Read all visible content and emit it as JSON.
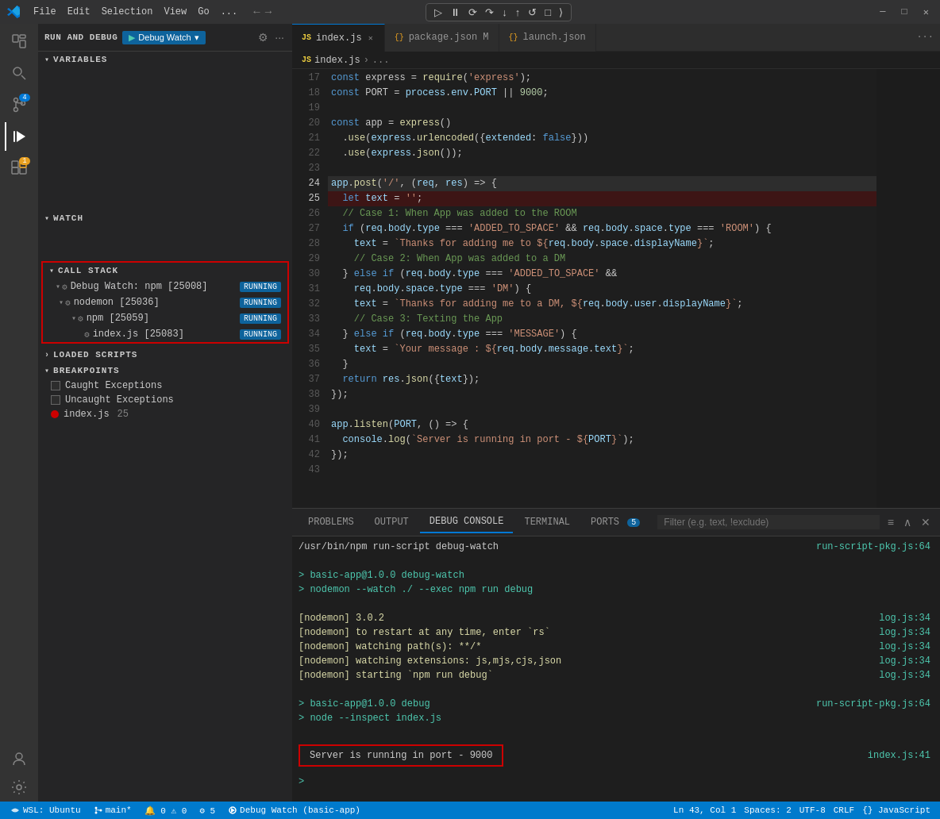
{
  "titlebar": {
    "menus": [
      "File",
      "Edit",
      "Selection",
      "View",
      "Go",
      "..."
    ],
    "debug_toolbar": {
      "buttons": [
        "⏸",
        "▶",
        "⟳",
        "↓",
        "↑",
        "↺",
        "□",
        "⟩",
        "≡"
      ]
    },
    "window_controls": [
      "─",
      "□",
      "✕"
    ]
  },
  "activity_bar": {
    "icons": [
      {
        "name": "explorer-icon",
        "symbol": "⬡",
        "active": false
      },
      {
        "name": "search-icon",
        "symbol": "🔍",
        "active": false
      },
      {
        "name": "source-control-icon",
        "symbol": "⎇",
        "active": false,
        "badge": "4"
      },
      {
        "name": "run-debug-icon",
        "symbol": "▷",
        "active": true
      },
      {
        "name": "extensions-icon",
        "symbol": "⊞",
        "active": false,
        "badge": "1",
        "badge_color": "orange"
      },
      {
        "name": "accounts-icon",
        "symbol": "👤",
        "active": false,
        "bottom": true
      },
      {
        "name": "settings-icon",
        "symbol": "⚙",
        "active": false,
        "bottom": true
      }
    ]
  },
  "sidebar": {
    "run_debug_label": "RUN AND DEBUG",
    "debug_config": "Debug Watch",
    "sections": {
      "variables": {
        "label": "VARIABLES",
        "expanded": true
      },
      "watch": {
        "label": "WATCH",
        "expanded": true
      },
      "call_stack": {
        "label": "CALL STACK",
        "expanded": true,
        "items": [
          {
            "label": "Debug Watch: npm [25008]",
            "status": "RUNNING",
            "indent": 0
          },
          {
            "label": "nodemon [25036]",
            "status": "RUNNING",
            "indent": 1
          },
          {
            "label": "npm [25059]",
            "status": "RUNNING",
            "indent": 2
          },
          {
            "label": "index.js [25083]",
            "status": "RUNNING",
            "indent": 3
          }
        ]
      },
      "loaded_scripts": {
        "label": "LOADED SCRIPTS",
        "expanded": false
      },
      "breakpoints": {
        "label": "BREAKPOINTS",
        "expanded": true,
        "items": [
          {
            "label": "Caught Exceptions",
            "checked": false
          },
          {
            "label": "Uncaught Exceptions",
            "checked": false
          },
          {
            "label": "index.js",
            "is_file": true,
            "line": 25
          }
        ]
      }
    }
  },
  "editor": {
    "tabs": [
      {
        "label": "index.js",
        "icon": "JS",
        "active": true,
        "closeable": true
      },
      {
        "label": "package.json M",
        "icon": "{}",
        "active": false
      },
      {
        "label": "launch.json",
        "icon": "{}",
        "active": false
      }
    ],
    "breadcrumb": [
      "JS index.js",
      ">",
      "..."
    ],
    "lines": [
      {
        "num": 17,
        "content": "const express = require('express');",
        "tokens": [
          {
            "t": "keyword",
            "v": "const"
          },
          {
            "t": "op",
            "v": " express "
          },
          {
            "t": "op",
            "v": "= "
          },
          {
            "t": "func",
            "v": "require"
          },
          {
            "t": "op",
            "v": "("
          },
          {
            "t": "string",
            "v": "'express'"
          },
          {
            "t": "op",
            "v": ");"
          }
        ]
      },
      {
        "num": 18,
        "content": "const PORT = process.env.PORT || 9000;",
        "tokens": [
          {
            "t": "keyword",
            "v": "const"
          },
          {
            "t": "op",
            "v": " PORT "
          },
          {
            "t": "op",
            "v": "= "
          },
          {
            "t": "var",
            "v": "process"
          },
          {
            "t": "op",
            "v": "."
          },
          {
            "t": "prop",
            "v": "env"
          },
          {
            "t": "op",
            "v": "."
          },
          {
            "t": "prop",
            "v": "PORT"
          },
          {
            "t": "op",
            "v": " || "
          },
          {
            "t": "number",
            "v": "9000"
          },
          {
            "t": "op",
            "v": ";"
          }
        ]
      },
      {
        "num": 19,
        "content": ""
      },
      {
        "num": 20,
        "content": "const app = express()"
      },
      {
        "num": 21,
        "content": "  .use(express.urlencoded({extended: false}))"
      },
      {
        "num": 22,
        "content": "  .use(express.json());"
      },
      {
        "num": 23,
        "content": ""
      },
      {
        "num": 24,
        "content": "app.post('/', (req, res) => {",
        "highlighted": true
      },
      {
        "num": 25,
        "content": "  let text = '';",
        "breakpoint": true
      },
      {
        "num": 26,
        "content": "  // Case 1: When App was added to the ROOM"
      },
      {
        "num": 27,
        "content": "  if (req.body.type === 'ADDED_TO_SPACE' && req.body.space.type === 'ROOM') {"
      },
      {
        "num": 28,
        "content": "    text = `Thanks for adding me to ${req.body.space.displayName}`;"
      },
      {
        "num": 29,
        "content": "    // Case 2: When App was added to a DM"
      },
      {
        "num": 30,
        "content": "  } else if (req.body.type === 'ADDED_TO_SPACE' &&"
      },
      {
        "num": 31,
        "content": "    req.body.space.type === 'DM') {"
      },
      {
        "num": 32,
        "content": "    text = `Thanks for adding me to a DM, ${req.body.user.displayName}`;"
      },
      {
        "num": 33,
        "content": "    // Case 3: Texting the App"
      },
      {
        "num": 34,
        "content": "  } else if (req.body.type === 'MESSAGE') {"
      },
      {
        "num": 35,
        "content": "    text = `Your message : ${req.body.message.text}`;"
      },
      {
        "num": 36,
        "content": "  }"
      },
      {
        "num": 37,
        "content": "  return res.json({text});"
      },
      {
        "num": 38,
        "content": "});"
      },
      {
        "num": 39,
        "content": ""
      },
      {
        "num": 40,
        "content": "app.listen(PORT, () => {"
      },
      {
        "num": 41,
        "content": "  console.log(`Server is running in port - ${PORT}`);"
      },
      {
        "num": 42,
        "content": "});"
      },
      {
        "num": 43,
        "content": ""
      }
    ]
  },
  "panel": {
    "tabs": [
      {
        "label": "PROBLEMS",
        "active": false
      },
      {
        "label": "OUTPUT",
        "active": false
      },
      {
        "label": "DEBUG CONSOLE",
        "active": true
      },
      {
        "label": "TERMINAL",
        "active": false
      },
      {
        "label": "PORTS",
        "active": false,
        "badge": "5"
      }
    ],
    "filter_placeholder": "Filter (e.g. text, !exclude)",
    "console_lines": [
      {
        "text": "/usr/bin/npm run-script debug-watch",
        "link": "run-script-pkg.js:64",
        "color": ""
      },
      {
        "text": "",
        "link": "",
        "color": ""
      },
      {
        "text": "> basic-app@1.0.0 debug-watch",
        "link": "",
        "color": "green"
      },
      {
        "text": "> nodemon --watch ./ --exec npm run debug",
        "link": "",
        "color": "green"
      },
      {
        "text": "",
        "link": "",
        "color": ""
      },
      {
        "text": "[nodemon] 3.0.2",
        "link": "log.js:34",
        "color": "yellow"
      },
      {
        "text": "[nodemon] to restart at any time, enter `rs`",
        "link": "log.js:34",
        "color": "yellow"
      },
      {
        "text": "[nodemon] watching path(s): **/*",
        "link": "log.js:34",
        "color": "yellow"
      },
      {
        "text": "[nodemon] watching extensions: js,mjs,cjs,json",
        "link": "log.js:34",
        "color": "yellow"
      },
      {
        "text": "[nodemon] starting `npm run debug`",
        "link": "log.js:34",
        "color": "yellow"
      },
      {
        "text": "",
        "link": "",
        "color": ""
      },
      {
        "text": "> basic-app@1.0.0 debug",
        "link": "run-script-pkg.js:64",
        "color": "green"
      },
      {
        "text": "> node --inspect index.js",
        "link": "",
        "color": "green"
      },
      {
        "text": "",
        "link": "",
        "color": ""
      },
      {
        "text": "Server is running in port - 9000",
        "link": "index.js:41",
        "color": "server",
        "boxed": true
      }
    ],
    "chevron_prompt": ">"
  },
  "status_bar": {
    "left_items": [
      {
        "label": "WSL: Ubuntu",
        "icon": "remote"
      },
      {
        "label": "main*",
        "icon": "branch"
      },
      {
        "label": "🔔 0 ⚠ 0",
        "icon": ""
      },
      {
        "label": "⚙ 5",
        "icon": ""
      }
    ],
    "debug_label": "Debug Watch (basic-app)",
    "right_items": [
      {
        "label": "Ln 43, Col 1"
      },
      {
        "label": "Spaces: 2"
      },
      {
        "label": "UTF-8"
      },
      {
        "label": "CRLF"
      },
      {
        "label": "{} JavaScript"
      }
    ]
  }
}
